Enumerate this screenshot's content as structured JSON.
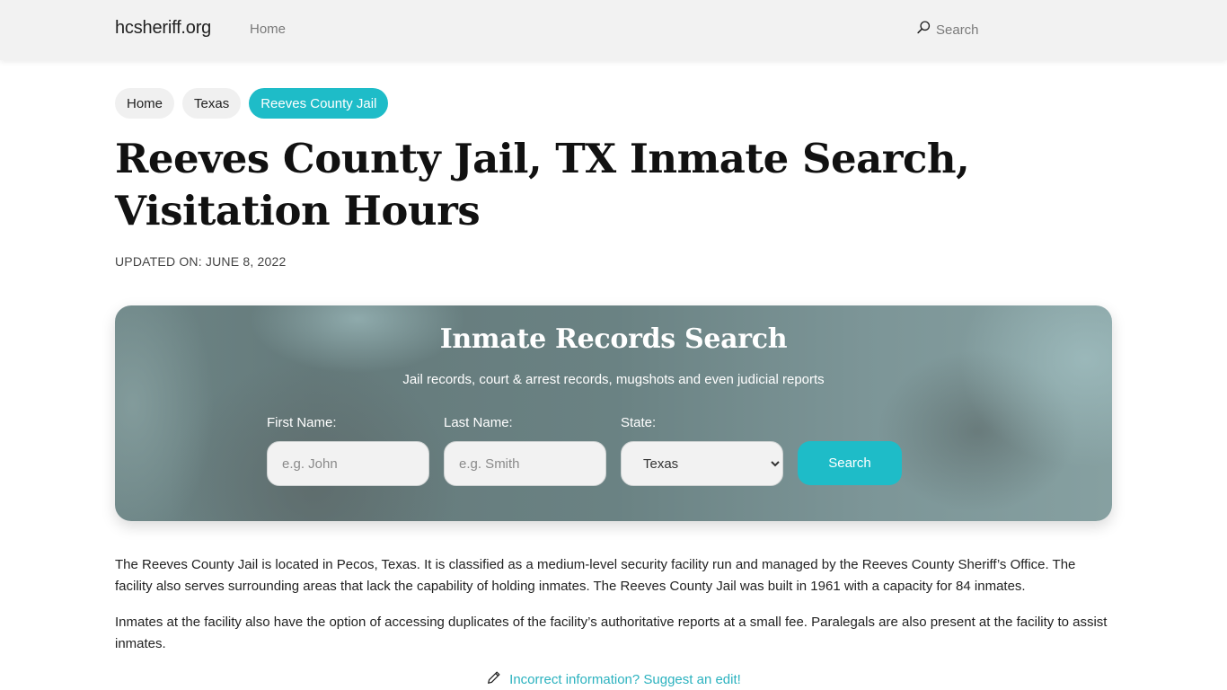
{
  "navbar": {
    "brand": "hcsheriff.org",
    "links": [
      {
        "label": "Home"
      }
    ],
    "search_label": "Search",
    "search_icon": "magnifier-icon"
  },
  "breadcrumb": [
    {
      "label": "Home",
      "active": false
    },
    {
      "label": "Texas",
      "active": false
    },
    {
      "label": "Reeves County Jail",
      "active": true
    }
  ],
  "page": {
    "title": "Reeves County Jail, TX Inmate Search, Visitation Hours",
    "updated": "UPDATED ON: JUNE 8, 2022"
  },
  "search_card": {
    "title": "Inmate Records Search",
    "subtitle": "Jail records, court & arrest records, mugshots and even judicial reports",
    "first_name": {
      "label": "First Name:",
      "placeholder": "e.g. John",
      "value": ""
    },
    "last_name": {
      "label": "Last Name:",
      "placeholder": "e.g. Smith",
      "value": ""
    },
    "state": {
      "label": "State:",
      "selected": "Texas"
    },
    "button_label": "Search"
  },
  "content": {
    "paragraphs": [
      "The Reeves County Jail is located in Pecos, Texas. It is classified as a medium-level security facility run and managed by the Reeves County Sheriff’s Office. The facility also serves surrounding areas that lack the capability of holding inmates. The Reeves County Jail was built in 1961 with a capacity for 84 inmates.",
      "Inmates at the facility also have the option of accessing duplicates of the facility’s authoritative reports at a small fee. Paralegals are also present at the facility to assist inmates."
    ],
    "suggest_edit": "Incorrect information? Suggest an edit!",
    "suggest_icon": "pencil-icon"
  },
  "colors": {
    "accent": "#1ebcc8",
    "link": "#2bb2bf",
    "navbar_bg": "#f2f2f2"
  }
}
